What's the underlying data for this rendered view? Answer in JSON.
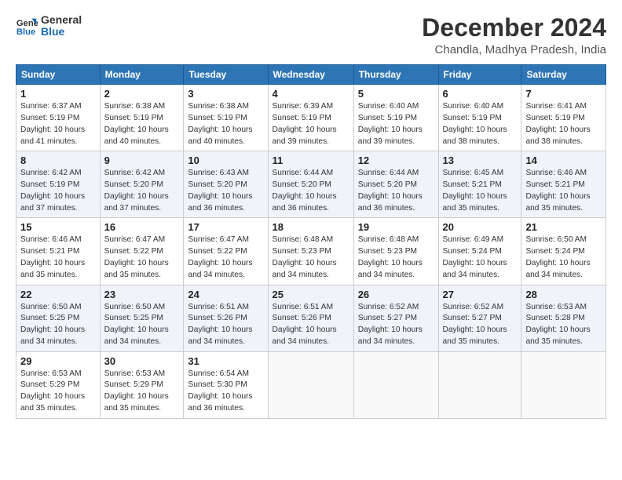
{
  "logo": {
    "line1": "General",
    "line2": "Blue"
  },
  "title": "December 2024",
  "subtitle": "Chandla, Madhya Pradesh, India",
  "headers": [
    "Sunday",
    "Monday",
    "Tuesday",
    "Wednesday",
    "Thursday",
    "Friday",
    "Saturday"
  ],
  "weeks": [
    [
      {
        "day": "1",
        "info": "Sunrise: 6:37 AM\nSunset: 5:19 PM\nDaylight: 10 hours\nand 41 minutes."
      },
      {
        "day": "2",
        "info": "Sunrise: 6:38 AM\nSunset: 5:19 PM\nDaylight: 10 hours\nand 40 minutes."
      },
      {
        "day": "3",
        "info": "Sunrise: 6:38 AM\nSunset: 5:19 PM\nDaylight: 10 hours\nand 40 minutes."
      },
      {
        "day": "4",
        "info": "Sunrise: 6:39 AM\nSunset: 5:19 PM\nDaylight: 10 hours\nand 39 minutes."
      },
      {
        "day": "5",
        "info": "Sunrise: 6:40 AM\nSunset: 5:19 PM\nDaylight: 10 hours\nand 39 minutes."
      },
      {
        "day": "6",
        "info": "Sunrise: 6:40 AM\nSunset: 5:19 PM\nDaylight: 10 hours\nand 38 minutes."
      },
      {
        "day": "7",
        "info": "Sunrise: 6:41 AM\nSunset: 5:19 PM\nDaylight: 10 hours\nand 38 minutes."
      }
    ],
    [
      {
        "day": "8",
        "info": "Sunrise: 6:42 AM\nSunset: 5:19 PM\nDaylight: 10 hours\nand 37 minutes."
      },
      {
        "day": "9",
        "info": "Sunrise: 6:42 AM\nSunset: 5:20 PM\nDaylight: 10 hours\nand 37 minutes."
      },
      {
        "day": "10",
        "info": "Sunrise: 6:43 AM\nSunset: 5:20 PM\nDaylight: 10 hours\nand 36 minutes."
      },
      {
        "day": "11",
        "info": "Sunrise: 6:44 AM\nSunset: 5:20 PM\nDaylight: 10 hours\nand 36 minutes."
      },
      {
        "day": "12",
        "info": "Sunrise: 6:44 AM\nSunset: 5:20 PM\nDaylight: 10 hours\nand 36 minutes."
      },
      {
        "day": "13",
        "info": "Sunrise: 6:45 AM\nSunset: 5:21 PM\nDaylight: 10 hours\nand 35 minutes."
      },
      {
        "day": "14",
        "info": "Sunrise: 6:46 AM\nSunset: 5:21 PM\nDaylight: 10 hours\nand 35 minutes."
      }
    ],
    [
      {
        "day": "15",
        "info": "Sunrise: 6:46 AM\nSunset: 5:21 PM\nDaylight: 10 hours\nand 35 minutes."
      },
      {
        "day": "16",
        "info": "Sunrise: 6:47 AM\nSunset: 5:22 PM\nDaylight: 10 hours\nand 35 minutes."
      },
      {
        "day": "17",
        "info": "Sunrise: 6:47 AM\nSunset: 5:22 PM\nDaylight: 10 hours\nand 34 minutes."
      },
      {
        "day": "18",
        "info": "Sunrise: 6:48 AM\nSunset: 5:23 PM\nDaylight: 10 hours\nand 34 minutes."
      },
      {
        "day": "19",
        "info": "Sunrise: 6:48 AM\nSunset: 5:23 PM\nDaylight: 10 hours\nand 34 minutes."
      },
      {
        "day": "20",
        "info": "Sunrise: 6:49 AM\nSunset: 5:24 PM\nDaylight: 10 hours\nand 34 minutes."
      },
      {
        "day": "21",
        "info": "Sunrise: 6:50 AM\nSunset: 5:24 PM\nDaylight: 10 hours\nand 34 minutes."
      }
    ],
    [
      {
        "day": "22",
        "info": "Sunrise: 6:50 AM\nSunset: 5:25 PM\nDaylight: 10 hours\nand 34 minutes."
      },
      {
        "day": "23",
        "info": "Sunrise: 6:50 AM\nSunset: 5:25 PM\nDaylight: 10 hours\nand 34 minutes."
      },
      {
        "day": "24",
        "info": "Sunrise: 6:51 AM\nSunset: 5:26 PM\nDaylight: 10 hours\nand 34 minutes."
      },
      {
        "day": "25",
        "info": "Sunrise: 6:51 AM\nSunset: 5:26 PM\nDaylight: 10 hours\nand 34 minutes."
      },
      {
        "day": "26",
        "info": "Sunrise: 6:52 AM\nSunset: 5:27 PM\nDaylight: 10 hours\nand 34 minutes."
      },
      {
        "day": "27",
        "info": "Sunrise: 6:52 AM\nSunset: 5:27 PM\nDaylight: 10 hours\nand 35 minutes."
      },
      {
        "day": "28",
        "info": "Sunrise: 6:53 AM\nSunset: 5:28 PM\nDaylight: 10 hours\nand 35 minutes."
      }
    ],
    [
      {
        "day": "29",
        "info": "Sunrise: 6:53 AM\nSunset: 5:29 PM\nDaylight: 10 hours\nand 35 minutes."
      },
      {
        "day": "30",
        "info": "Sunrise: 6:53 AM\nSunset: 5:29 PM\nDaylight: 10 hours\nand 35 minutes."
      },
      {
        "day": "31",
        "info": "Sunrise: 6:54 AM\nSunset: 5:30 PM\nDaylight: 10 hours\nand 36 minutes."
      },
      {
        "day": "",
        "info": ""
      },
      {
        "day": "",
        "info": ""
      },
      {
        "day": "",
        "info": ""
      },
      {
        "day": "",
        "info": ""
      }
    ]
  ]
}
